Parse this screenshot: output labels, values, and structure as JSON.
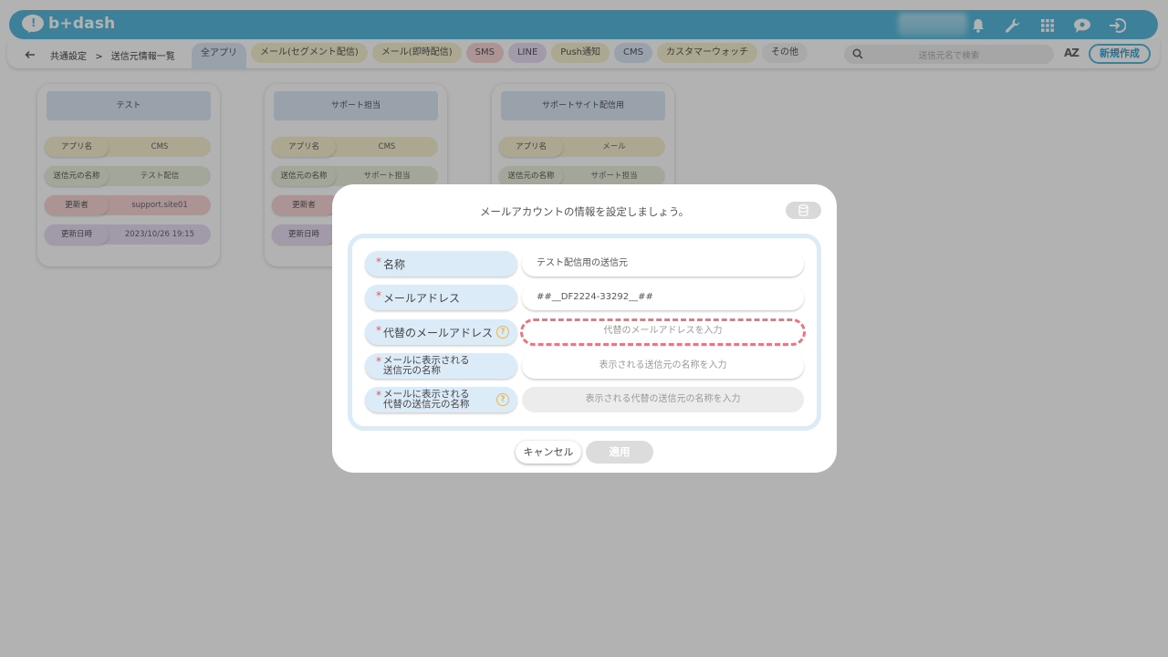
{
  "app": {
    "logo_text": "b+dash"
  },
  "nav": {
    "breadcrumb_parent": "共通設定",
    "breadcrumb_sep": ">",
    "breadcrumb_current": "送信元情報一覧",
    "tabs": [
      {
        "label": "全アプリ",
        "bg": "#dce9f5",
        "active": true
      },
      {
        "label": "メール(セグメント配信)",
        "bg": "#f6efce"
      },
      {
        "label": "メール(即時配信)",
        "bg": "#f6efce"
      },
      {
        "label": "SMS",
        "bg": "#f7d4d6"
      },
      {
        "label": "LINE",
        "bg": "#e8ddf3"
      },
      {
        "label": "Push通知",
        "bg": "#f6efce"
      },
      {
        "label": "CMS",
        "bg": "#dce9f5"
      },
      {
        "label": "カスタマーウォッチ",
        "bg": "#f6efce"
      },
      {
        "label": "その他",
        "bg": "#f3f3f3"
      }
    ],
    "search_placeholder": "送信元名で検索",
    "sort_label": "AZ",
    "new_button": "新規作成"
  },
  "cards": [
    {
      "title": "テスト",
      "rows": [
        {
          "label": "アプリ名",
          "value": "CMS",
          "bg": "#f6efce"
        },
        {
          "label": "送信元の名称",
          "value": "テスト配信",
          "bg": "#e9f0dc"
        },
        {
          "label": "更新者",
          "value": "support.site01",
          "bg": "#f7d4d6"
        },
        {
          "label": "更新日時",
          "value": "2023/10/26 19:15",
          "bg": "#e8ddf3"
        }
      ]
    },
    {
      "title": "サポート担当",
      "rows": [
        {
          "label": "アプリ名",
          "value": "CMS",
          "bg": "#f6efce"
        },
        {
          "label": "送信元の名称",
          "value": "サポート担当",
          "bg": "#e9f0dc"
        },
        {
          "label": "更新者",
          "value": "",
          "bg": "#f7d4d6"
        },
        {
          "label": "更新日時",
          "value": "",
          "bg": "#e8ddf3"
        }
      ]
    },
    {
      "title": "サポートサイト配信用",
      "rows": [
        {
          "label": "アプリ名",
          "value": "メール",
          "bg": "#f6efce"
        },
        {
          "label": "送信元の名称",
          "value": "サポート担当",
          "bg": "#e9f0dc"
        }
      ]
    }
  ],
  "modal": {
    "title": "メールアカウントの情報を設定しましょう。",
    "required_mark": "*",
    "help_glyph": "?",
    "fields": {
      "name": {
        "label": "名称",
        "value": "テスト配信用の送信元"
      },
      "email": {
        "label": "メールアドレス",
        "value": "##__DF2224-33292__##"
      },
      "alt_email": {
        "label": "代替のメールアドレス",
        "placeholder": "代替のメールアドレスを入力"
      },
      "display_name": {
        "label_line1": "メールに表示される",
        "label_line2": "送信元の名称",
        "placeholder": "表示される送信元の名称を入力"
      },
      "alt_display_name": {
        "label_line1": "メールに表示される",
        "label_line2": "代替の送信元の名称",
        "placeholder": "表示される代替の送信元の名称を入力"
      }
    },
    "cancel": "キャンセル",
    "apply": "適用"
  },
  "colors": {
    "brand": "#57b9dc",
    "error_border": "#e8787f",
    "label_bg": "#dcebf8",
    "help": "#e9b84a"
  }
}
